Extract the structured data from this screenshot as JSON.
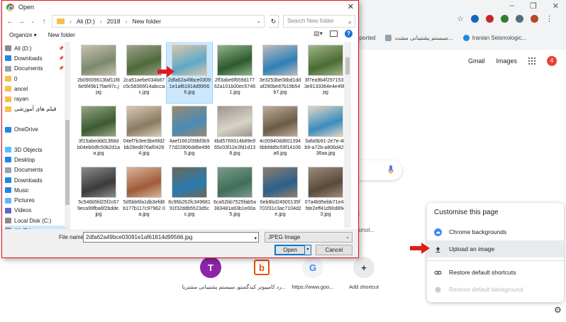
{
  "browser": {
    "bookmarks": [
      "...ported",
      "سیستم پشتیبانی مشت...",
      "Iranian Seismologic..."
    ],
    "google_links": {
      "gmail": "Gmail",
      "images": "Images",
      "notifications": "4"
    },
    "shortcuts": [
      {
        "letter": "T",
        "label": "سیستم پشتیبانی مشتریا...",
        "color": "#8e24aa"
      },
      {
        "letter": "b",
        "label": "رد کامپیوتر کیدگستو...",
        "color": "#e65100"
      },
      {
        "letter": "G",
        "label": "https://www.goo...",
        "color": "#4285f4"
      },
      {
        "letter": "+",
        "label": "Add shortcut",
        "color": "#e8eaed"
      }
    ],
    "partial_text": "esmol...",
    "customise": {
      "title": "Customise this page",
      "items": [
        {
          "label": "Chrome backgrounds",
          "icon": "cloud-icon"
        },
        {
          "label": "Upload an image",
          "icon": "upload-icon"
        },
        {
          "label": "Restore default shortcuts",
          "icon": "link-icon"
        },
        {
          "label": "Restore default background",
          "icon": "restore-icon"
        }
      ]
    }
  },
  "dialog": {
    "title": "Open",
    "path": [
      "Ali (D:)",
      "2018",
      "New folder"
    ],
    "search_placeholder": "Search New folder",
    "organize": "Organize ▾",
    "new_folder": "New folder",
    "tree": [
      {
        "label": "Ali (D:)",
        "icon": "drive-icon",
        "pinned": true
      },
      {
        "label": "Downloads",
        "icon": "download-icon",
        "pinned": true
      },
      {
        "label": "Documents",
        "icon": "documents-icon",
        "pinned": true
      },
      {
        "label": "0",
        "icon": "folder-icon"
      },
      {
        "label": "ancel",
        "icon": "folder-icon"
      },
      {
        "label": "rayan",
        "icon": "folder-icon"
      },
      {
        "label": "فیلم های آموزشی",
        "icon": "folder-icon"
      },
      {
        "label": "",
        "icon": ""
      },
      {
        "label": "OneDrive",
        "icon": "cloud-icon"
      },
      {
        "label": "",
        "icon": ""
      },
      {
        "label": "3D Objects",
        "icon": "cube-icon"
      },
      {
        "label": "Desktop",
        "icon": "desktop-icon"
      },
      {
        "label": "Documents",
        "icon": "documents-icon"
      },
      {
        "label": "Downloads",
        "icon": "download-icon"
      },
      {
        "label": "Music",
        "icon": "music-icon"
      },
      {
        "label": "Pictures",
        "icon": "pictures-icon"
      },
      {
        "label": "Videos",
        "icon": "videos-icon"
      },
      {
        "label": "Local Disk (C:)",
        "icon": "drive-icon"
      },
      {
        "label": "Ali (D:)",
        "icon": "drive-icon",
        "selected": true
      }
    ],
    "files": [
      {
        "name": "2b09009613faf11f86e5f49b17fae97c.jpg",
        "colors": [
          "#7a8a6a",
          "#c8c0b0"
        ]
      },
      {
        "name": "2ca51aebe034b87c5c58366f14abccac.jpg",
        "colors": [
          "#4f6a3a",
          "#9aa38a"
        ]
      },
      {
        "name": "2dfa62a49bce03091e1af61814d99566.jpg",
        "colors": [
          "#5fa8c8",
          "#d9c6a8"
        ],
        "selected": true
      },
      {
        "name": "2ff3abe6f659d17762a101b00ec57481.jpg",
        "colors": [
          "#2e5a2e",
          "#8fb38a"
        ]
      },
      {
        "name": "3e3253be08bd1ddaf290be87b19b54b7.jpg",
        "colors": [
          "#2f7fb8",
          "#bcbcbc"
        ]
      },
      {
        "name": "3f7ea9b4f29715313e9133364e4e49f.jpg",
        "colors": [
          "#4a6b34",
          "#a2b58a"
        ]
      },
      {
        "name": "3f15abeddd1368db04eb0dfc50b2d1aa.jpg",
        "colors": [
          "#3c5a30",
          "#96a685"
        ]
      },
      {
        "name": "04ef7b3ee3be6fd2bb28ed876af04284.jpg",
        "colors": [
          "#8b7a62",
          "#d6cbb6"
        ]
      },
      {
        "name": "4aef1661f39bf3b977d22806dd6e4965.jpg",
        "colors": [
          "#4a8ab8",
          "#9a8a6a"
        ]
      },
      {
        "name": "4bd5769314b89e965c03f12e2fd1d138.jpg",
        "colors": [
          "#d8d3c8",
          "#9c958a"
        ]
      },
      {
        "name": "4c00940dd6013946bbfdd5c59f14106a6.jpg",
        "colors": [
          "#6a5a48",
          "#bfae98"
        ]
      },
      {
        "name": "5afa5b91-2e7e-48b9-a72b-a806d42136aa.jpg",
        "colors": [
          "#3b8cc0",
          "#e0d6c0"
        ]
      },
      {
        "name": "5c546b5fd25f2c679eca99fba6f2bdde.jpg",
        "colors": [
          "#3a3a3a",
          "#8c8c8c"
        ]
      },
      {
        "name": "5d5bb6fa1db3efd8b177b117c97962 0a.jpg",
        "colors": [
          "#a05a3a",
          "#d8b89a"
        ]
      },
      {
        "name": "6c96b262fc34968191f32ddb5523d5cc.jpg",
        "colors": [
          "#2a7ab0",
          "#6a6a5a"
        ]
      },
      {
        "name": "6ca52bb7525fab5a383481a93b1e00a5.jpg",
        "colors": [
          "#3f6f5a",
          "#7a9a8a"
        ]
      },
      {
        "name": "6eb8bd24900135f701f31c3ac7104d2e.jpg",
        "colors": [
          "#2d5f8a",
          "#8a8070"
        ]
      },
      {
        "name": "07a4b95ebb71e43fde2eff41d90d8943.jpg",
        "colors": [
          "#5a4a3a",
          "#9c8c7a"
        ]
      }
    ],
    "filename_label": "File name:",
    "filename_value": "2dfa62a49bce03091e1af61814d99566.jpg",
    "filetype": "JPEG Image",
    "open_label": "Open",
    "cancel_label": "Cancel"
  }
}
